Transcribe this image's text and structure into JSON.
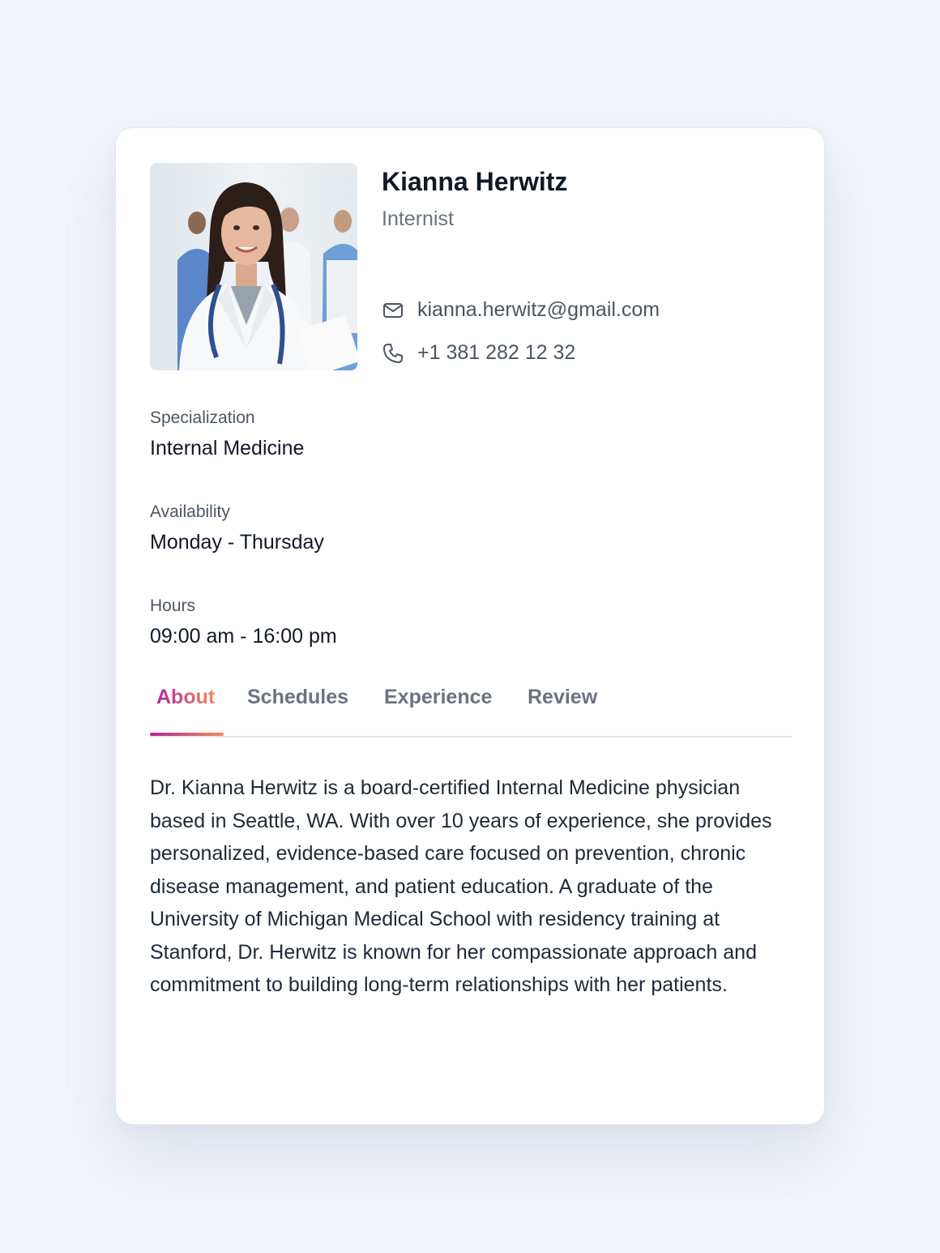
{
  "profile": {
    "name": "Kianna Herwitz",
    "role": "Internist",
    "email": "kianna.herwitz@gmail.com",
    "phone": "+1 381 282 12 32",
    "photo_icon": "doctor-portrait"
  },
  "fields": {
    "specialization_label": "Specialization",
    "specialization_value": "Internal Medicine",
    "availability_label": "Availability",
    "availability_value": "Monday - Thursday",
    "hours_label": "Hours",
    "hours_value": "09:00 am - 16:00 pm"
  },
  "tabs": [
    {
      "label": "About",
      "active": true
    },
    {
      "label": "Schedules",
      "active": false
    },
    {
      "label": "Experience",
      "active": false
    },
    {
      "label": "Review",
      "active": false
    }
  ],
  "about": {
    "text": "Dr. Kianna Herwitz is a board-certified Internal Medicine physician based in Seattle, WA. With over 10 years of experience, she provides personalized, evidence-based care focused on prevention, chronic disease management, and patient education. A graduate of the University of Michigan Medical School with residency training at Stanford, Dr. Herwitz is known for her compassionate approach and commitment to building long-term relationships with her patients."
  },
  "colors": {
    "accent_start": "#b0279b",
    "accent_end": "#f08a5d",
    "page_bg": "#f1f4f9"
  }
}
